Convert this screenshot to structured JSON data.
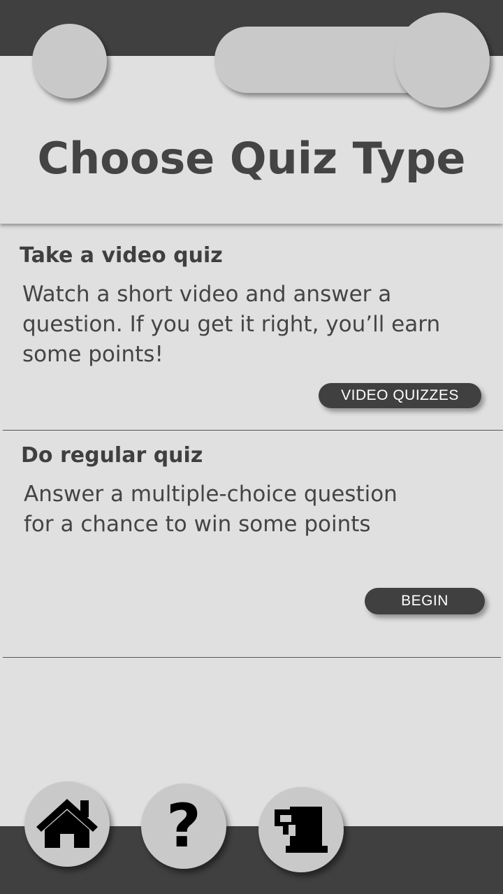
{
  "header": {
    "title": "Choose Quiz Type"
  },
  "cards": [
    {
      "title": "Take a video quiz",
      "description_lines": [
        "Watch a short video and answer a",
        "question. If you get it right, you’ll earn",
        "some points!"
      ],
      "button_label": "VIDEO QUIZZES"
    },
    {
      "title": "Do regular quiz",
      "description_lines": [
        "Answer a multiple-choice question",
        "for a chance to win some points"
      ],
      "button_label": "BEGIN"
    }
  ],
  "bottom_nav": {
    "items": [
      {
        "icon": "home-icon"
      },
      {
        "icon": "help-icon",
        "glyph": "?"
      },
      {
        "icon": "store-icon"
      }
    ]
  },
  "colors": {
    "dark_band": "#404040",
    "background": "#e0e0e0",
    "circle": "#c9c9c9"
  }
}
